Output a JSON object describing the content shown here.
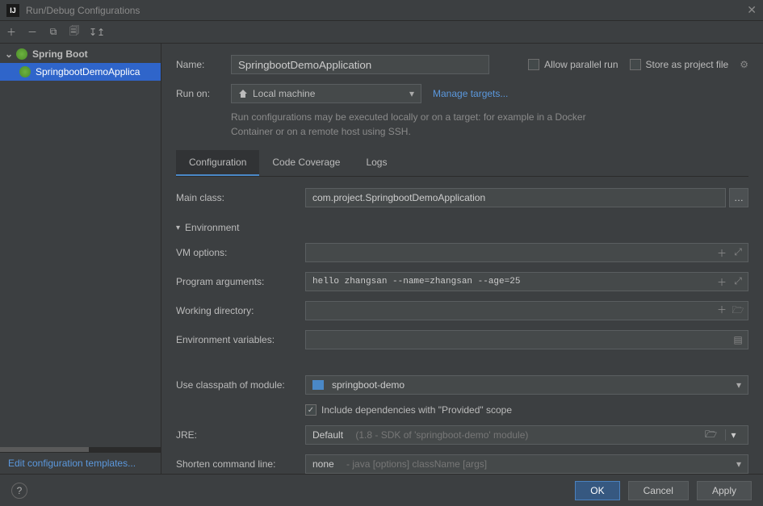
{
  "window": {
    "title": "Run/Debug Configurations"
  },
  "sidebar": {
    "group": "Spring Boot",
    "item": "SpringbootDemoApplica",
    "editTemplates": "Edit configuration templates..."
  },
  "header": {
    "nameLabel": "Name:",
    "nameValue": "SpringbootDemoApplication",
    "allowParallel": "Allow parallel run",
    "storeAsProjectFile": "Store as project file",
    "runOnLabel": "Run on:",
    "runOnValue": "Local machine",
    "manageTargets": "Manage targets...",
    "hint": "Run configurations may be executed locally or on a target: for example in a Docker Container or on a remote host using SSH."
  },
  "tabs": [
    "Configuration",
    "Code Coverage",
    "Logs"
  ],
  "form": {
    "mainClassLabel": "Main class:",
    "mainClassValue": "com.project.SpringbootDemoApplication",
    "environmentHeader": "Environment",
    "vmOptionsLabel": "VM options:",
    "vmOptionsValue": "",
    "programArgsLabel": "Program arguments:",
    "programArgsValue": "hello zhangsan --name=zhangsan --age=25",
    "workingDirLabel": "Working directory:",
    "workingDirValue": "",
    "envVarsLabel": "Environment variables:",
    "envVarsValue": "",
    "classpathLabel": "Use classpath of module:",
    "classpathValue": "springboot-demo",
    "includeProvided": "Include dependencies with \"Provided\" scope",
    "jreLabel": "JRE:",
    "jreValue": "Default",
    "jreDim": "(1.8 - SDK of 'springboot-demo' module)",
    "shortenLabel": "Shorten command line:",
    "shortenValue": "none",
    "shortenDim": "- java [options] className [args]"
  },
  "buttons": {
    "ok": "OK",
    "cancel": "Cancel",
    "apply": "Apply"
  }
}
